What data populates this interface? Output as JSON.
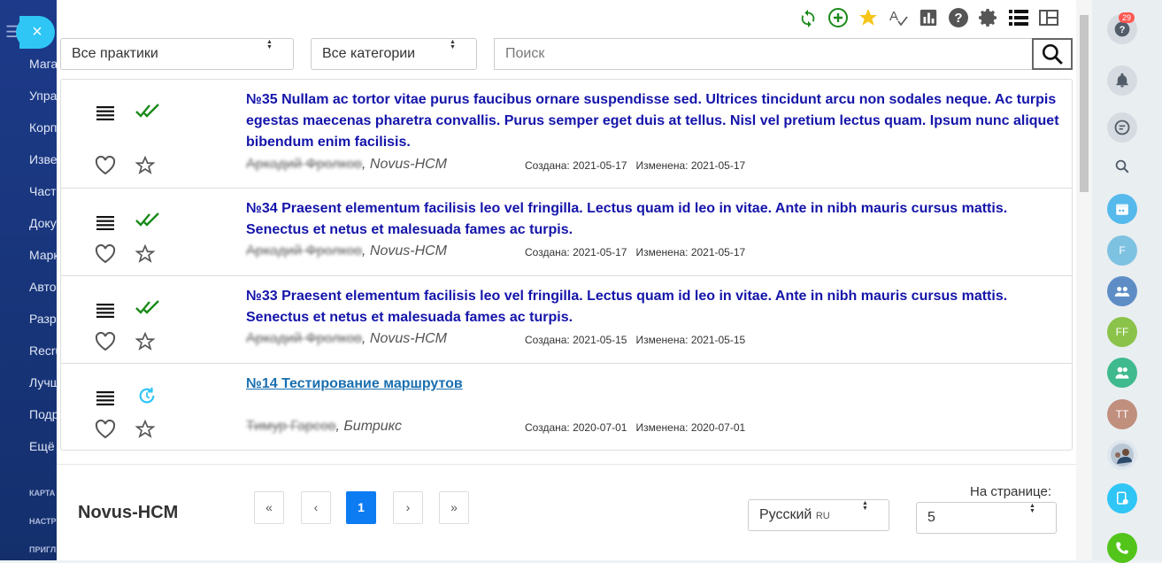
{
  "left_nav": {
    "items": [
      "Мага",
      "Упра",
      "Корп",
      "Изве",
      "Част",
      "Доку",
      "Марк",
      "Авто",
      "Разр",
      "Recru",
      "Лучш",
      "Подр",
      "Ещё"
    ],
    "small_labels": [
      "КАРТА",
      "НАСТР",
      "ПРИГЛ"
    ]
  },
  "close_icon": "×",
  "toolbar": {
    "icons": [
      "refresh-icon",
      "add-icon",
      "star-icon",
      "spellcheck-icon",
      "report-icon",
      "help-icon",
      "settings-icon",
      "list-view-icon",
      "grid-view-icon"
    ]
  },
  "filters": {
    "practices": "Все практики",
    "categories": "Все категории",
    "search_placeholder": "Поиск"
  },
  "items": [
    {
      "title": "№35 Nullam ac tortor vitae purus faucibus ornare suspendisse sed. Ultrices tincidunt arcu non sodales neque. Ac turpis egestas maecenas pharetra convallis. Purus semper eget duis at tellus. Nisl vel pretium lectus quam. Ipsum nunc aliquet bibendum enim facilisis.",
      "author": "Аркадий Фролков",
      "company": ", Novus-HCM",
      "created": "Создана: 2021-05-17",
      "modified": "Изменена: 2021-05-17",
      "status": "approved"
    },
    {
      "title": "№34 Praesent elementum facilisis leo vel fringilla. Lectus quam id leo in vitae. Ante in nibh mauris cursus mattis. Senectus et netus et malesuada fames ac turpis.",
      "author": "Аркадий Фролков",
      "company": ", Novus-HCM",
      "created": "Создана: 2021-05-17",
      "modified": "Изменена: 2021-05-17",
      "status": "approved"
    },
    {
      "title": "№33 Praesent elementum facilisis leo vel fringilla. Lectus quam id leo in vitae. Ante in nibh mauris cursus mattis. Senectus et netus et malesuada fames ac turpis.",
      "author": "Аркадий Фролков",
      "company": ", Novus-HCM",
      "created": "Создана: 2021-05-15",
      "modified": "Изменена: 2021-05-15",
      "status": "approved"
    },
    {
      "title": "№14 Тестирование маршрутов",
      "author": "Тимур Гарсов",
      "company": ", Битрикс",
      "created": "Создана: 2020-07-01",
      "modified": "Изменена: 2020-07-01",
      "status": "pending"
    }
  ],
  "footer": {
    "brand": "Novus-HCM",
    "pagination": [
      "«",
      "‹",
      "1",
      "›",
      "»"
    ],
    "language": "Русский",
    "language_code": "RU",
    "per_page_label": "На странице:",
    "per_page_value": "5"
  },
  "right_panel": {
    "help_badge": "29",
    "avatar_f": "F",
    "avatar_ff": "FF",
    "avatar_tt": "TT"
  },
  "colors": {
    "accent": "#0d7cf2",
    "title_blue": "#1414aa",
    "approved_green": "#1a8a1a",
    "pending_cyan": "#2fc6f6"
  }
}
